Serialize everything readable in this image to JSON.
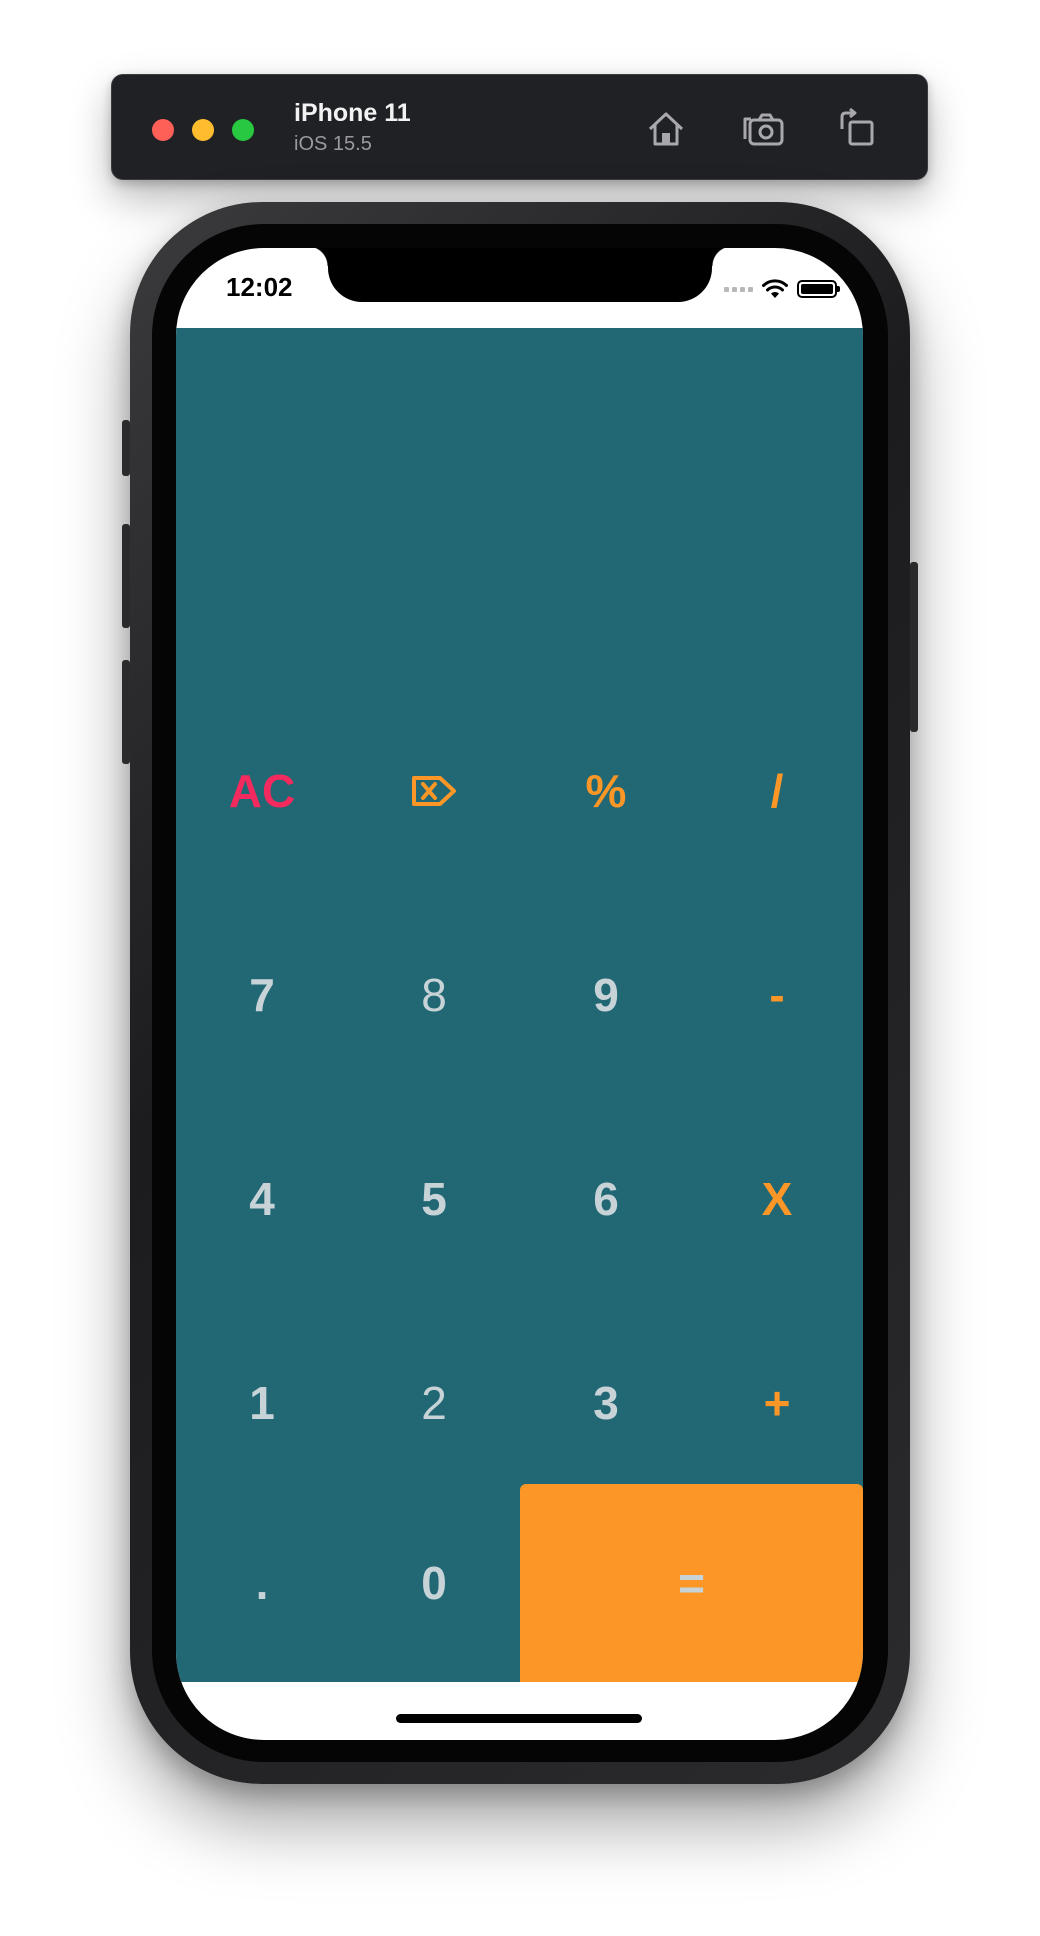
{
  "simulator": {
    "device_name": "iPhone 11",
    "os_version": "iOS 15.5",
    "toolbar_icons": [
      "home-icon",
      "screenshot-icon",
      "rotate-icon"
    ]
  },
  "status_bar": {
    "time": "12:02"
  },
  "calculator": {
    "display_value": "",
    "colors": {
      "background": "#216874",
      "digit": "#c8d3d8",
      "operator": "#fb9627",
      "clear": "#f22a5e",
      "equals_background": "#fb9627"
    },
    "keys": {
      "clear": "AC",
      "backspace_icon": "backspace-icon",
      "percent": "%",
      "divide": "/",
      "seven": "7",
      "eight": "8",
      "nine": "9",
      "minus": "-",
      "four": "4",
      "five": "5",
      "six": "6",
      "multiply": "X",
      "one": "1",
      "two": "2",
      "three": "3",
      "plus": "+",
      "dot": ".",
      "zero": "0",
      "equals": "="
    }
  }
}
